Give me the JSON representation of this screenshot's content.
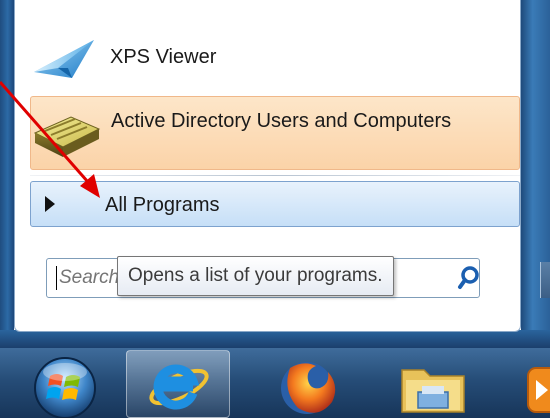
{
  "start_menu": {
    "pinned": [
      {
        "label": "XPS Viewer",
        "icon": "xps-viewer-icon"
      },
      {
        "label": "Active Directory Users and Computers",
        "icon": "active-directory-icon",
        "highlighted": true
      }
    ],
    "all_programs": {
      "label": "All Programs",
      "icon": "expand-arrow-icon"
    },
    "search": {
      "placeholder": "Search programs and files",
      "visible_text": "Sear",
      "icon": "search-icon"
    },
    "tooltip": {
      "text": "Opens a list of your programs."
    }
  },
  "taskbar": {
    "items": [
      {
        "name": "start-button",
        "icon": "windows-orb-icon"
      },
      {
        "name": "internet-explorer",
        "icon": "internet-explorer-icon",
        "active": true
      },
      {
        "name": "firefox",
        "icon": "firefox-icon"
      },
      {
        "name": "windows-explorer",
        "icon": "folder-icon"
      },
      {
        "name": "media-player",
        "icon": "media-player-icon"
      }
    ]
  },
  "annotation": {
    "type": "arrow",
    "color": "#e00000",
    "points_to": "all-programs"
  },
  "colors": {
    "highlight_orange": "#fbd3a8",
    "highlight_blue": "#c6dff7",
    "taskbar": "#264d78",
    "annotation_red": "#e00000"
  }
}
